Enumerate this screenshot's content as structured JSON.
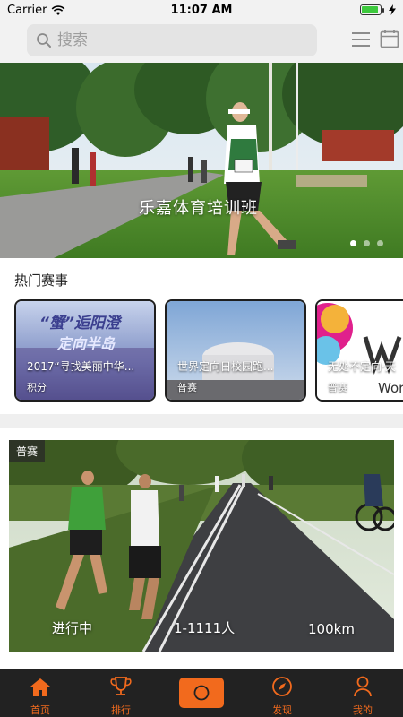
{
  "status_bar": {
    "carrier": "Carrier",
    "time": "11:07 AM",
    "battery_level": 0.9
  },
  "header": {
    "search_placeholder": "搜索",
    "icons": [
      "search-icon",
      "menu-icon",
      "calendar-icon"
    ]
  },
  "banner": {
    "title": "乐嘉体育培训班",
    "slide_count": 3,
    "active_slide": 1
  },
  "hot_events": {
    "title": "热门赛事",
    "items": [
      {
        "poster_text_1": "“蟹”逅阳澄",
        "poster_text_2": "定向半岛",
        "name": "2017“寻找美丽中华...",
        "tag": "积分"
      },
      {
        "name": "世界定向日校园跑...",
        "tag": "普赛"
      },
      {
        "name": "无处不定向·天",
        "tag": "普赛",
        "poster_text": "World"
      }
    ]
  },
  "featured": {
    "badge": "普赛",
    "status": "进行中",
    "participants": "1-1111人",
    "distance": "100km"
  },
  "tabbar": {
    "items": [
      {
        "label": "首页",
        "icon": "home-icon"
      },
      {
        "label": "排行",
        "icon": "trophy-icon"
      },
      {
        "label": "",
        "icon": "record-button-icon"
      },
      {
        "label": "发现",
        "icon": "compass-icon"
      },
      {
        "label": "我的",
        "icon": "user-icon"
      }
    ]
  },
  "colors": {
    "accent": "#f26a1d",
    "tabbar_bg": "#222222",
    "header_bg": "#f2f2f2"
  }
}
